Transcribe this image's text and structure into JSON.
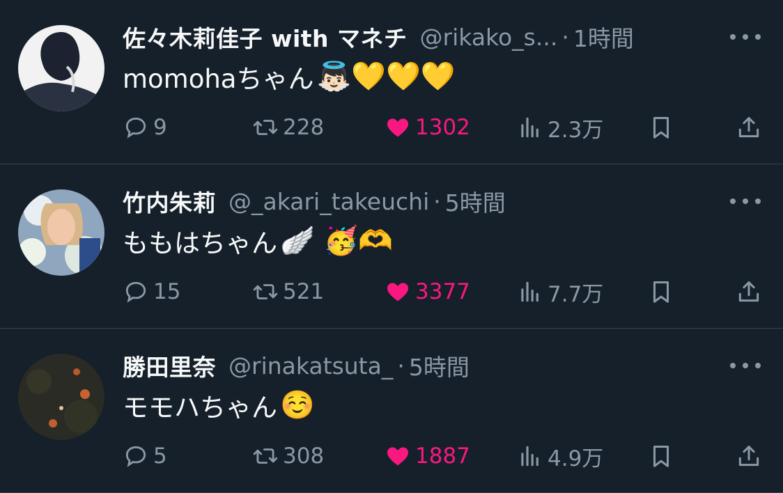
{
  "tweets": [
    {
      "name": "佐々木莉佳子 with マネチ",
      "handle": "@rikako_s...",
      "time": "1時間",
      "text": "momohaちゃん",
      "emojis": "👼🏻💛💛💛",
      "replies": "9",
      "retweets": "228",
      "likes": "1302",
      "views": "2.3万",
      "liked": true
    },
    {
      "name": "竹内朱莉",
      "handle": "@_akari_takeuchi",
      "time": "5時間",
      "text": "ももはちゃん",
      "emojis": "🪽 🥳🫶",
      "replies": "15",
      "retweets": "521",
      "likes": "3377",
      "views": "7.7万",
      "liked": true
    },
    {
      "name": "勝田里奈",
      "handle": "@rinakatsuta_",
      "time": "5時間",
      "text": "モモハちゃん",
      "emojis": "☺️",
      "replies": "5",
      "retweets": "308",
      "likes": "1887",
      "views": "4.9万",
      "liked": true
    }
  ],
  "colors": {
    "background": "#15202b",
    "muted": "#8b98a5",
    "like": "#f91880",
    "divider": "#38444d"
  },
  "icons": [
    "reply-icon",
    "retweet-icon",
    "heart-icon",
    "views-icon",
    "bookmark-icon",
    "share-icon",
    "more-icon"
  ]
}
